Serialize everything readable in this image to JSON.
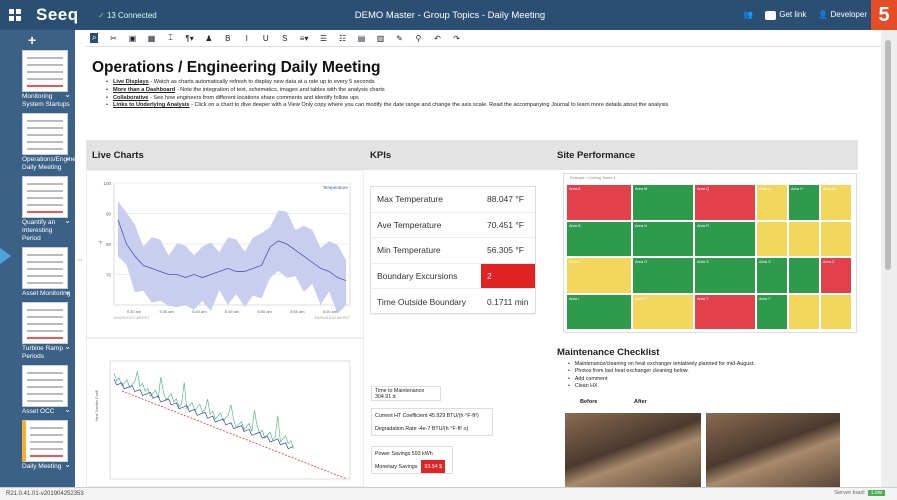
{
  "app": {
    "logo": "Seeq",
    "connected": "13 Connected",
    "title": "DEMO Master - Group Topics - Daily Meeting",
    "get_link": "Get link",
    "user": "Developer",
    "html5_badge": "5"
  },
  "sidebar": {
    "items": [
      {
        "label": "Monitoring System Startups"
      },
      {
        "label": "Operations/Engineering Daily Meeting"
      },
      {
        "label": "Quantify an Interesting Period"
      },
      {
        "label": "Asset Monitoring"
      },
      {
        "label": "Turbine Ramp Periods"
      },
      {
        "label": "Asset OCC"
      },
      {
        "label": "Daily Meeting"
      }
    ]
  },
  "toolbar": {
    "items": [
      "⌕",
      "✂",
      "▣",
      "▦",
      "⌶",
      "¶▾",
      "♟",
      "B",
      "I",
      "U",
      "S",
      "≡▾",
      "☰",
      "☷",
      "▤",
      "▥",
      "✎",
      "⚲",
      "↶",
      "↷"
    ]
  },
  "doc": {
    "heading": "Operations / Engineering Daily Meeting",
    "bullets": [
      {
        "bold": "Live Displays",
        "text": " - Watch as charts automatically refresh to display new data at a rate up to every 5 seconds"
      },
      {
        "bold": "More than a Dashboard",
        "text": " - Note the integration of text, schematics, images and tables with the analysis charts"
      },
      {
        "bold": "Collaborative",
        "text": " - See how engineers from different locations share comments and identify follow ups"
      },
      {
        "bold": "Links to Underlying Analysis",
        "text": " - Click on a chart to dive deeper with a View Only copy where you can modify the date range and change the axis scale. Read the accompanying Journal to learn more details about the analysis"
      }
    ],
    "sections": {
      "live": "Live Charts",
      "kpis": "KPIs",
      "site": "Site Performance"
    }
  },
  "chart_data": [
    {
      "type": "line",
      "series": [
        {
          "name": "Temperature",
          "values": [
            88,
            80,
            76,
            73,
            72,
            71,
            70,
            70,
            69,
            70,
            69,
            70,
            71,
            72,
            71,
            71,
            72,
            73,
            79,
            81,
            80,
            78,
            76,
            74,
            72,
            71,
            69,
            68
          ]
        }
      ],
      "ylim": [
        60,
        100
      ],
      "yticks": [
        100,
        90,
        80,
        70
      ],
      "ylabel": "°F",
      "x": [
        "5:30 am",
        "5:35 am",
        "5:40 am",
        "5:45 am",
        "5:50 am",
        "5:55 am",
        "6:00 am"
      ],
      "start": "5/4/2019 5:27 AM PDT",
      "end": "5/4/2019 6:02 AM PDT"
    },
    {
      "type": "scatter",
      "ylabel": "Heat Transfer Coeff"
    }
  ],
  "kpis": [
    {
      "label": "Max Temperature",
      "value": "88.047 °F",
      "alert": false
    },
    {
      "label": "Ave Temperature",
      "value": "70.451 °F",
      "alert": false
    },
    {
      "label": "Min Temperature",
      "value": "56.305 °F",
      "alert": false
    },
    {
      "label": "Boundary Excursions",
      "value": "2",
      "alert": true
    },
    {
      "label": "Time Outside Boundary",
      "value": "0.1711 min",
      "alert": false
    }
  ],
  "heatmap": {
    "title": "Example › Cooling Tower 4",
    "cells": [
      [
        "Area A",
        "r"
      ],
      [
        "Area M",
        "g"
      ],
      [
        "Area Q",
        "r"
      ],
      [
        "Area U",
        "y"
      ],
      [
        "Area V",
        "g"
      ],
      [
        "Area W",
        "y"
      ],
      [
        "Area B",
        "g"
      ],
      [
        "Area N",
        "g"
      ],
      [
        "Area R",
        "g"
      ],
      [
        "",
        "y"
      ],
      [
        "",
        "y"
      ],
      [
        "",
        "y"
      ],
      [
        "Area C",
        "y"
      ],
      [
        "Area O",
        "g"
      ],
      [
        "Area S",
        "g"
      ],
      [
        "Area X",
        "g"
      ],
      [
        "",
        "g"
      ],
      [
        "Area Z",
        "r"
      ],
      [
        "Area I",
        "g"
      ],
      [
        "Area P",
        "y"
      ],
      [
        "Area T",
        "r"
      ],
      [
        "Area Y",
        "g"
      ],
      [
        "",
        "y"
      ],
      [
        "",
        "y"
      ]
    ]
  },
  "exchanger": {
    "time_to_maint": "Time to Maintenance  304.91 d",
    "ht_coeff": "Current HT Coefficient  45.929 BTU/(h·°F·ft²)",
    "degradation": "Degradation Rate  -4e-7 BTU/(h·°F·ft²·s)",
    "power": "Power Savings  593 kWh",
    "monetary_label": "Monetary Savings",
    "monetary_value": "93.54 $"
  },
  "maintenance": {
    "title": "Maintenance Checklist",
    "items": [
      "Maintenance/cleaning on heat exchanger tentatively planned for mid-August.",
      "Photos from last heat exchanger cleaning below.",
      "Add comment",
      "Clean HX"
    ],
    "before": "Before",
    "after": "After"
  },
  "status": {
    "version": "R21.0.41.01-v201904252353",
    "server_load": "Server load:",
    "server_load_value": "Low"
  }
}
